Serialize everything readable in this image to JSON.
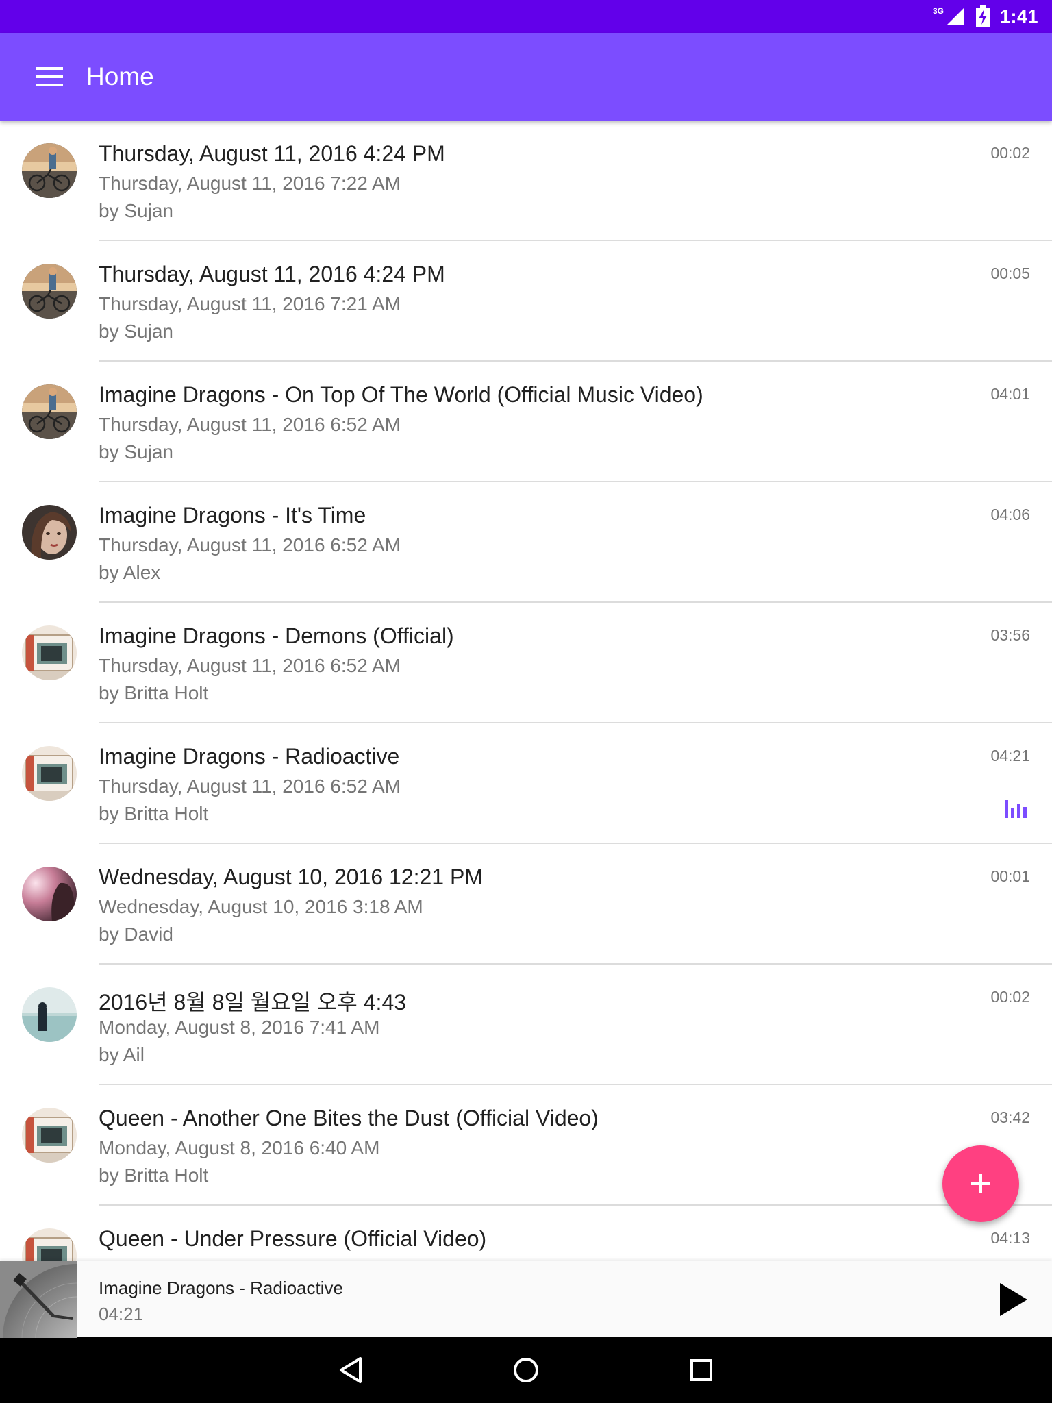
{
  "status_bar": {
    "network": "3G",
    "time": "1:41"
  },
  "app_bar": {
    "title": "Home",
    "menu_icon": "hamburger-menu-icon",
    "color": "#7c4dff",
    "status_color": "#6200ea"
  },
  "songs": [
    {
      "title": "Thursday, August 11, 2016 4:24 PM",
      "date": "Thursday, August 11, 2016 7:22 AM",
      "author": "by Sujan",
      "duration": "00:02",
      "avatar": "bike-girl"
    },
    {
      "title": "Thursday, August 11, 2016 4:24 PM",
      "date": "Thursday, August 11, 2016 7:21 AM",
      "author": "by Sujan",
      "duration": "00:05",
      "avatar": "bike-girl"
    },
    {
      "title": "Imagine Dragons - On Top Of The World (Official Music Video)",
      "date": "Thursday, August 11, 2016 6:52 AM",
      "author": "by Sujan",
      "duration": "04:01",
      "avatar": "bike-girl"
    },
    {
      "title": "Imagine Dragons - It's Time",
      "date": "Thursday, August 11, 2016 6:52 AM",
      "author": "by Alex",
      "duration": "04:06",
      "avatar": "portrait"
    },
    {
      "title": "Imagine Dragons - Demons (Official)",
      "date": "Thursday, August 11, 2016 6:52 AM",
      "author": "by Britta Holt",
      "duration": "03:56",
      "avatar": "van"
    },
    {
      "title": "Imagine Dragons - Radioactive",
      "date": "Thursday, August 11, 2016 6:52 AM",
      "author": "by Britta Holt",
      "duration": "04:21",
      "avatar": "van",
      "playing": true
    },
    {
      "title": "Wednesday, August 10, 2016 12:21 PM",
      "date": "Wednesday, August 10, 2016 3:18 AM",
      "author": "by David",
      "duration": "00:01",
      "avatar": "sunset"
    },
    {
      "title": "2016년 8월 8일 월요일 오후 4:43",
      "date": "Monday, August 8, 2016 7:41 AM",
      "author": "by Ail",
      "duration": "00:02",
      "avatar": "sea"
    },
    {
      "title": "Queen - Another One Bites the Dust (Official Video)",
      "date": "Monday, August 8, 2016 6:40 AM",
      "author": "by Britta Holt",
      "duration": "03:42",
      "avatar": "van"
    },
    {
      "title": "Queen - Under Pressure (Official Video)",
      "date": "",
      "author": "",
      "duration": "04:13",
      "avatar": "van"
    }
  ],
  "fab": {
    "icon": "plus-icon",
    "color": "#ff4081"
  },
  "now_playing": {
    "title": "Imagine Dragons - Radioactive",
    "time": "04:21",
    "art_icon": "turntable-icon",
    "play_icon": "play-icon"
  },
  "nav_bar": {
    "back_icon": "back-triangle-icon",
    "home_icon": "home-circle-icon",
    "recents_icon": "recents-square-icon"
  }
}
